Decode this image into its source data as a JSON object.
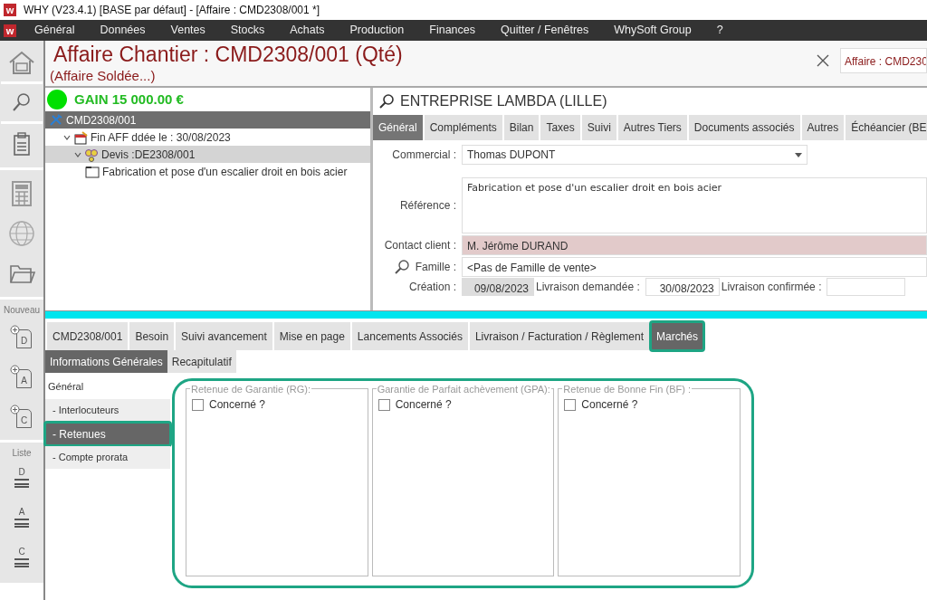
{
  "window": {
    "logo": "w",
    "title": "WHY (V23.4.1)  [BASE par défaut] - [Affaire : CMD2308/001 *]"
  },
  "menu": {
    "logo": "w",
    "items": [
      "Général",
      "Données",
      "Ventes",
      "Stocks",
      "Achats",
      "Production",
      "Finances",
      "Quitter / Fenêtres",
      "WhySoft Group",
      "?"
    ]
  },
  "sidebar": [
    {
      "kind": "new",
      "label": "Nouveau",
      "items": [
        {
          "letter": "D"
        },
        {
          "letter": "A"
        },
        {
          "letter": "C"
        }
      ]
    },
    {
      "kind": "list",
      "label": "Liste",
      "items": [
        {
          "letter": "D"
        },
        {
          "letter": "A"
        },
        {
          "letter": "C"
        }
      ]
    }
  ],
  "header": {
    "title": "Affaire Chantier : CMD2308/001 (Qté)",
    "subtitle": "(Affaire Soldée...)",
    "search_value": "Affaire : CMD230"
  },
  "gain": {
    "label": "GAIN  15 000.00 €"
  },
  "tree": [
    {
      "label": "CMD2308/001",
      "selected": true,
      "highlighted": false,
      "children": [
        {
          "label": "Fin AFF ddée le : 30/08/2023",
          "selected": false,
          "highlighted": false,
          "expanded": true,
          "children": [
            {
              "label": "Devis :DE2308/001",
              "selected": false,
              "highlighted": true,
              "expanded": true,
              "children": [
                {
                  "label": "Fabrication et pose d'un escalier droit en bois acier",
                  "selected": false,
                  "highlighted": false
                }
              ]
            }
          ]
        }
      ]
    }
  ],
  "client": {
    "name": "ENTREPRISE LAMBDA  (LILLE)"
  },
  "form_tabs": [
    {
      "label": "Général",
      "selected": true
    },
    {
      "label": "Compléments",
      "selected": false
    },
    {
      "label": "Bilan",
      "selected": false
    },
    {
      "label": "Taxes",
      "selected": false
    },
    {
      "label": "Suivi",
      "selected": false
    },
    {
      "label": "Autres Tiers",
      "selected": false
    },
    {
      "label": "Documents associés",
      "selected": false
    },
    {
      "label": "Autres",
      "selected": false
    },
    {
      "label": "Échéancier (BE",
      "selected": false
    }
  ],
  "form": {
    "commercial": {
      "label": "Commercial :",
      "value": "Thomas DUPONT"
    },
    "reference": {
      "label": "Référence :",
      "value": "Fabrication et pose d'un escalier droit en bois acier"
    },
    "contact": {
      "label": "Contact client :",
      "value": "M. Jérôme DURAND"
    },
    "famille": {
      "label": "Famille :",
      "value": "<Pas de Famille de vente>"
    },
    "creation": {
      "label": "Création :",
      "value": "09/08/2023"
    },
    "livraison_demandee": {
      "label": "Livraison demandée :",
      "value": "30/08/2023"
    },
    "livraison_confirmee": {
      "label": "Livraison confirmée :"
    }
  },
  "bottom_tabs": [
    {
      "label": "CMD2308/001",
      "selected": false,
      "annotated": false
    },
    {
      "label": "Besoin",
      "selected": false,
      "annotated": false
    },
    {
      "label": "Suivi avancement",
      "selected": false,
      "annotated": false
    },
    {
      "label": "Mise en page",
      "selected": false,
      "annotated": false
    },
    {
      "label": "Lancements Associés",
      "selected": false,
      "annotated": false
    },
    {
      "label": "Livraison / Facturation / Règlement",
      "selected": false,
      "annotated": false
    },
    {
      "label": "Marchés",
      "selected": true,
      "annotated": true
    }
  ],
  "sub_tabs": [
    {
      "label": "Informations Générales",
      "selected": true
    },
    {
      "label": "Recapitulatif",
      "selected": false
    }
  ],
  "nav": [
    {
      "label": "Général",
      "kind": "heading",
      "selected": false,
      "annotated": false
    },
    {
      "label": "- Interlocuteurs",
      "kind": "item",
      "selected": false,
      "annotated": false
    },
    {
      "label": "- Retenues",
      "kind": "item",
      "selected": true,
      "annotated": true
    },
    {
      "label": "- Compte prorata",
      "kind": "item",
      "selected": false,
      "annotated": false
    }
  ],
  "panels_annotated": true,
  "panels": [
    {
      "title": "Retenue de Garantie (RG):",
      "checkbox": {
        "label": "Concerné ?",
        "checked": false
      }
    },
    {
      "title": "Garantie de Parfait achèvement (GPA):",
      "checkbox": {
        "label": "Concerné ?",
        "checked": false
      }
    },
    {
      "title": "Retenue de Bonne Fin (BF) :",
      "checkbox": {
        "label": "Concerné ?",
        "checked": false
      }
    }
  ]
}
